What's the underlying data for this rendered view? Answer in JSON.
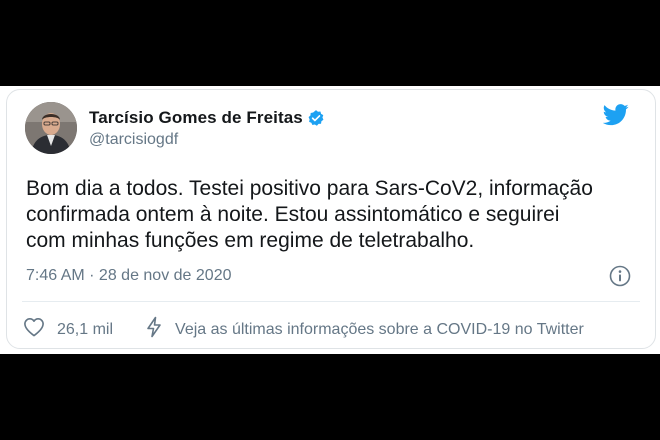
{
  "tweet": {
    "author": {
      "name": "Tarcísio Gomes de Freitas",
      "handle": "@tarcisiogdf",
      "verified": true
    },
    "text": "Bom dia a todos. Testei positivo para Sars-CoV2, informação\nconfirmada ontem à noite. Estou assintomático e seguirei\ncom minhas funções em regime de teletrabalho.",
    "timestamp": "7:46 AM · 28 de nov de 2020",
    "likes": "26,1 mil",
    "covid_link": "Veja as últimas informações sobre a COVID-19 no Twitter"
  },
  "icons": {
    "twitter": "twitter-bird-icon",
    "verified": "verified-badge-icon",
    "info": "info-icon",
    "like": "heart-icon",
    "covid": "lightning-icon"
  },
  "colors": {
    "twitter_blue": "#1da1f2",
    "text_primary": "#14171a",
    "text_secondary": "#657786",
    "border": "#dfe3e6",
    "frame": "#000000"
  }
}
